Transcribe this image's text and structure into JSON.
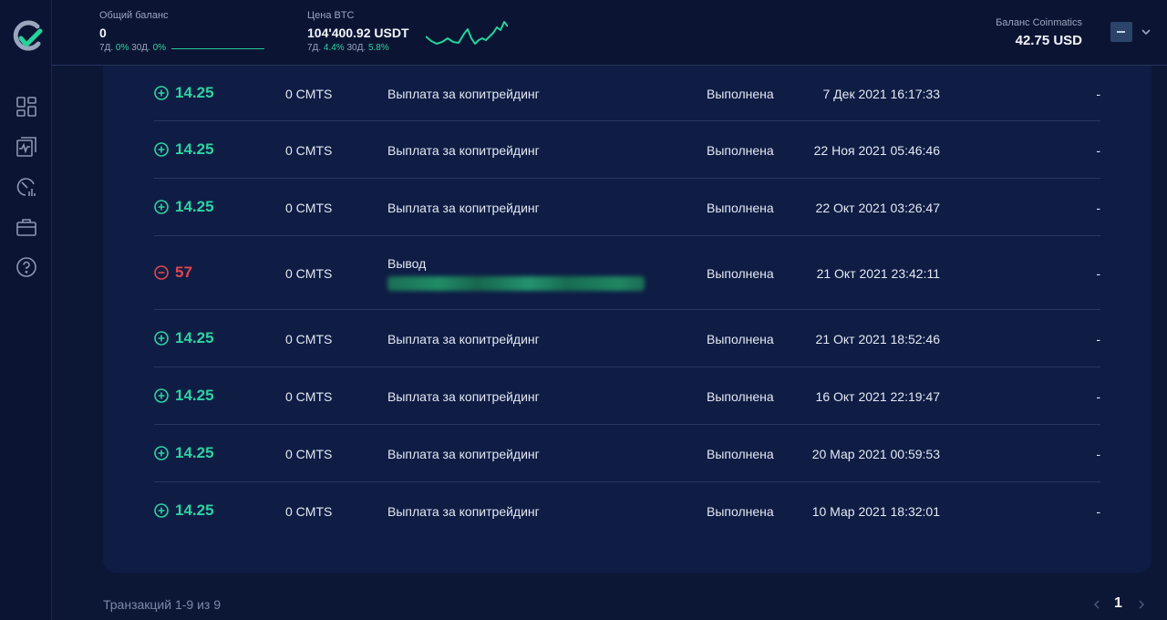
{
  "header": {
    "total_balance_label": "Общий баланс",
    "total_balance_value": "0",
    "total_balance_change": {
      "d7_label": "7Д.",
      "d7_value": "0%",
      "d30_label": "30Д.",
      "d30_value": "0%"
    },
    "btc_label": "Цена BTC",
    "btc_value": "104'400.92 USDT",
    "btc_change": {
      "d7_label": "7Д.",
      "d7_value": "4.4%",
      "d30_label": "30Д.",
      "d30_value": "5.8%"
    },
    "coinmatics_label": "Баланс Coinmatics",
    "coinmatics_value": "42.75 USD"
  },
  "sidebar": {
    "items": [
      {
        "icon": "dashboard-icon"
      },
      {
        "icon": "portfolio-icon"
      },
      {
        "icon": "analytics-icon"
      },
      {
        "icon": "briefcase-icon"
      },
      {
        "icon": "help-icon"
      }
    ]
  },
  "transactions": [
    {
      "sign": "+",
      "amount": "14.25",
      "currency": "0 CMTS",
      "description": "Выплата за копитрейдинг",
      "status": "Выполнена",
      "date": "7 Дек 2021 16:17:33",
      "extra": "-"
    },
    {
      "sign": "+",
      "amount": "14.25",
      "currency": "0 CMTS",
      "description": "Выплата за копитрейдинг",
      "status": "Выполнена",
      "date": "22 Ноя 2021 05:46:46",
      "extra": "-"
    },
    {
      "sign": "+",
      "amount": "14.25",
      "currency": "0 CMTS",
      "description": "Выплата за копитрейдинг",
      "status": "Выполнена",
      "date": "22 Окт 2021 03:26:47",
      "extra": "-"
    },
    {
      "sign": "-",
      "amount": "57",
      "currency": "0 CMTS",
      "description": "Вывод",
      "status": "Выполнена",
      "date": "21 Окт 2021 23:42:11",
      "extra": "-"
    },
    {
      "sign": "+",
      "amount": "14.25",
      "currency": "0 CMTS",
      "description": "Выплата за копитрейдинг",
      "status": "Выполнена",
      "date": "21 Окт 2021 18:52:46",
      "extra": "-"
    },
    {
      "sign": "+",
      "amount": "14.25",
      "currency": "0 CMTS",
      "description": "Выплата за копитрейдинг",
      "status": "Выполнена",
      "date": "16 Окт 2021 22:19:47",
      "extra": "-"
    },
    {
      "sign": "+",
      "amount": "14.25",
      "currency": "0 CMTS",
      "description": "Выплата за копитрейдинг",
      "status": "Выполнена",
      "date": "20 Мар 2021 00:59:53",
      "extra": "-"
    },
    {
      "sign": "+",
      "amount": "14.25",
      "currency": "0 CMTS",
      "description": "Выплата за копитрейдинг",
      "status": "Выполнена",
      "date": "10 Мар 2021 18:32:01",
      "extra": "-"
    }
  ],
  "footer": {
    "summary": "Транзакций 1-9 из 9",
    "current_page": "1"
  },
  "colors": {
    "positive": "#2ed3a0",
    "negative": "#e0474c",
    "panel": "#0f1d45",
    "background": "#0c1736"
  }
}
